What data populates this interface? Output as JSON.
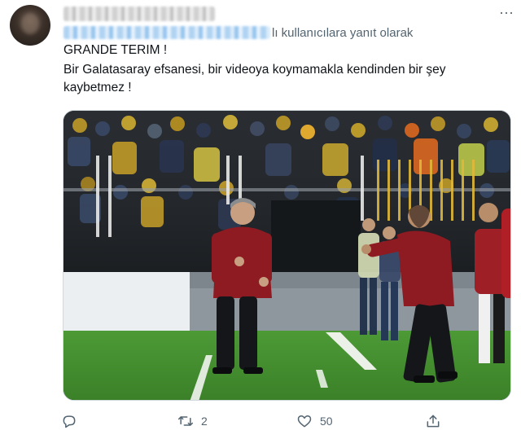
{
  "tweet": {
    "reply_context_suffix": "lı kullanıcılara yanıt olarak",
    "lines": [
      "GRANDE TERIM !",
      "Bir Galatasaray efsanesi, bir videoya koymamakla kendinden bir şey",
      "kaybetmez !"
    ],
    "media": {
      "icon": "photo",
      "colors": {
        "jacket": "#8e1b22",
        "pitch": "#3f8a2c",
        "board": "#eceff1"
      }
    },
    "actions": {
      "reply": {
        "icon": "reply-icon",
        "count": ""
      },
      "retweet": {
        "icon": "retweet-icon",
        "count": "2"
      },
      "like": {
        "icon": "heart-icon",
        "count": "50"
      },
      "share": {
        "icon": "share-icon",
        "count": ""
      }
    },
    "more_icon": "more-dots-icon"
  }
}
